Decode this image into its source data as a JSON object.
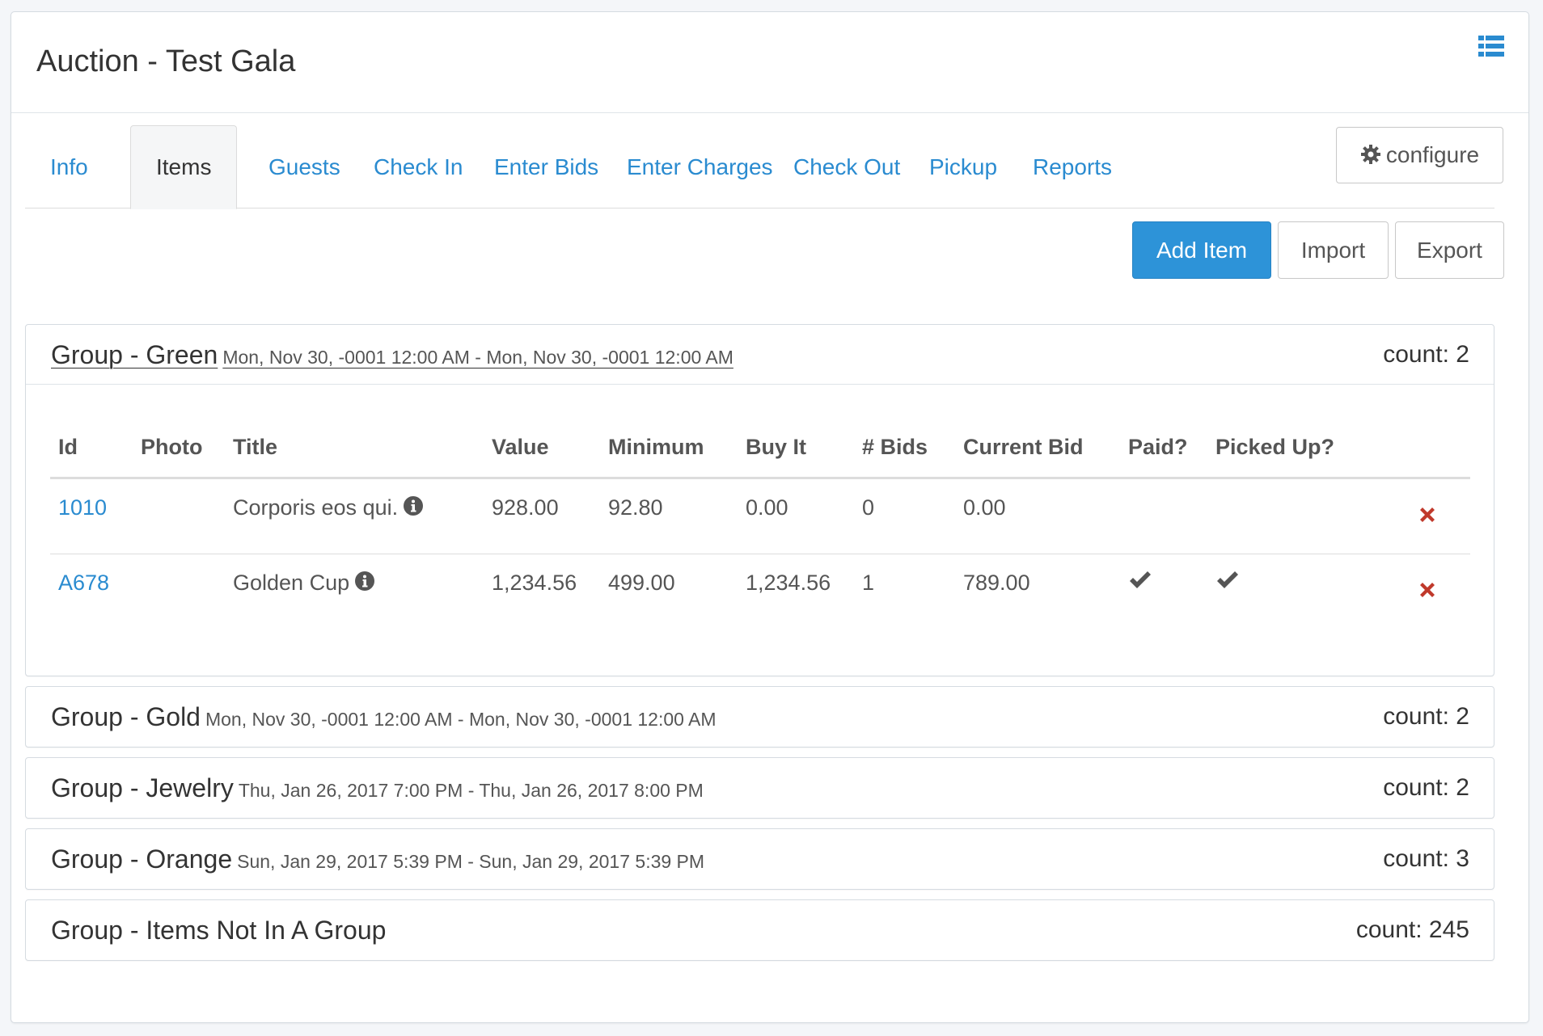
{
  "header": {
    "title": "Auction - Test Gala",
    "menu_icon": "list-icon"
  },
  "tabs": [
    {
      "label": "Info"
    },
    {
      "label": "Items"
    },
    {
      "label": "Guests"
    },
    {
      "label": "Check In"
    },
    {
      "label": "Enter Bids"
    },
    {
      "label": "Enter Charges"
    },
    {
      "label": "Check Out"
    },
    {
      "label": "Pickup"
    },
    {
      "label": "Reports"
    }
  ],
  "active_tab": "Items",
  "toolbar": {
    "configure_label": "configure",
    "add_label": "Add Item",
    "import_label": "Import",
    "export_label": "Export"
  },
  "colors": {
    "primary": "#2d93d8",
    "link": "#2a8bd0",
    "danger": "#c0392b"
  },
  "table": {
    "columns": [
      "Id",
      "Photo",
      "Title",
      "Value",
      "Minimum",
      "Buy It",
      "# Bids",
      "Current Bid",
      "Paid?",
      "Picked Up?"
    ],
    "rows": [
      {
        "id": "1010",
        "photo": "",
        "title": "Corporis eos qui.",
        "value": "928.00",
        "minimum": "92.80",
        "buy_it": "0.00",
        "bids": "0",
        "current_bid": "0.00",
        "paid": false,
        "picked_up": false
      },
      {
        "id": "A678",
        "photo": "",
        "title": "Golden Cup",
        "value": "1,234.56",
        "minimum": "499.00",
        "buy_it": "1,234.56",
        "bids": "1",
        "current_bid": "789.00",
        "paid": true,
        "picked_up": true
      }
    ]
  },
  "groups": [
    {
      "name": "Group - Green",
      "dates": "Mon, Nov 30, -0001 12:00 AM - Mon, Nov 30, -0001 12:00 AM",
      "count": "count: 2",
      "expanded": true
    },
    {
      "name": "Group - Gold",
      "dates": "Mon, Nov 30, -0001 12:00 AM - Mon, Nov 30, -0001 12:00 AM",
      "count": "count: 2"
    },
    {
      "name": "Group - Jewelry",
      "dates": "Thu, Jan 26, 2017 7:00 PM - Thu, Jan 26, 2017 8:00 PM",
      "count": "count: 2"
    },
    {
      "name": "Group - Orange",
      "dates": "Sun, Jan 29, 2017 5:39 PM - Sun, Jan 29, 2017 5:39 PM",
      "count": "count: 3"
    },
    {
      "name": "Group - Items Not In A Group",
      "dates": "",
      "count": "count: 245"
    }
  ]
}
